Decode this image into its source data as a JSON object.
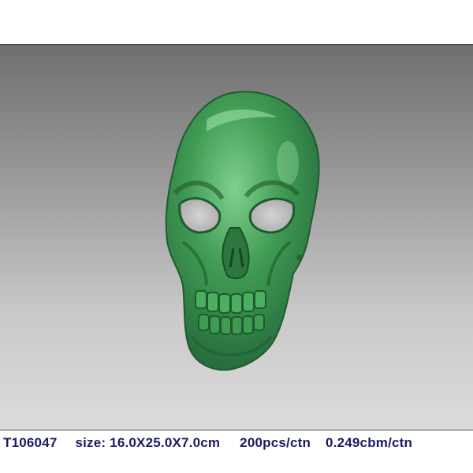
{
  "product": {
    "subject": "green plastic skull mask",
    "code": "T106047",
    "size": "size: 16.0X25.0X7.0cm",
    "packing": "200pcs/ctn",
    "volume": "0.249cbm/ctn"
  },
  "colors": {
    "mask_green": "#3f9a52",
    "mask_highlight": "#7fd08e",
    "mask_shadow": "#1f5a2e",
    "background_top": "#6f6f6f",
    "background_bottom": "#dcdcdc",
    "caption_text": "#1a1a66"
  }
}
